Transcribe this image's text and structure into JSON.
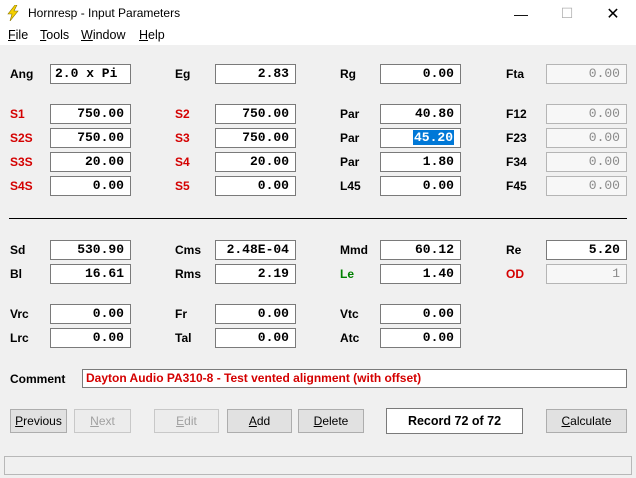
{
  "window": {
    "title": "Hornresp - Input Parameters",
    "close_glyph": "✕",
    "min_glyph": "—",
    "max_glyph": "☐"
  },
  "menu": [
    "File",
    "Tools",
    "Window",
    "Help"
  ],
  "params": {
    "Ang": "2.0 x Pi",
    "Eg": "2.83",
    "Rg": "0.00",
    "Fta": "0.00",
    "S1": "750.00",
    "S2": "750.00",
    "Par1": "40.80",
    "F12": "0.00",
    "S2S": "750.00",
    "S3": "750.00",
    "Par2": "45.20",
    "F23": "0.00",
    "S3S": "20.00",
    "S4": "20.00",
    "Par3": "1.80",
    "F34": "0.00",
    "S4S": "0.00",
    "S5": "0.00",
    "L45": "0.00",
    "F45": "0.00",
    "Sd": "530.90",
    "Cms": "2.48E-04",
    "Mmd": "60.12",
    "Re": "5.20",
    "Bl": "16.61",
    "Rms": "2.19",
    "Le": "1.40",
    "OD": "1",
    "Vrc": "0.00",
    "Fr": "0.00",
    "Vtc": "0.00",
    "Lrc": "0.00",
    "Tal": "0.00",
    "Atc": "0.00"
  },
  "labels": {
    "Ang": "Ang",
    "Eg": "Eg",
    "Rg": "Rg",
    "Fta": "Fta",
    "S1": "S1",
    "S2": "S2",
    "Par1": "Par",
    "F12": "F12",
    "S2S": "S2S",
    "S3": "S3",
    "Par2": "Par",
    "F23": "F23",
    "S3S": "S3S",
    "S4": "S4",
    "Par3": "Par",
    "F34": "F34",
    "S4S": "S4S",
    "S5": "S5",
    "L45": "L45",
    "F45": "F45",
    "Sd": "Sd",
    "Cms": "Cms",
    "Mmd": "Mmd",
    "Re": "Re",
    "Bl": "Bl",
    "Rms": "Rms",
    "Le": "Le",
    "OD": "OD",
    "Vrc": "Vrc",
    "Fr": "Fr",
    "Vtc": "Vtc",
    "Lrc": "Lrc",
    "Tal": "Tal",
    "Atc": "Atc",
    "Comment": "Comment"
  },
  "comment": "Dayton Audio PA310-8 - Test vented alignment (with offset)",
  "buttons": {
    "previous": "Previous",
    "next": "Next",
    "edit": "Edit",
    "add": "Add",
    "delete": "Delete",
    "calculate": "Calculate"
  },
  "record": "Record 72 of 72",
  "colors": {
    "label_red": "#d40000",
    "label_green": "#008000",
    "selection": "#0078d7"
  }
}
